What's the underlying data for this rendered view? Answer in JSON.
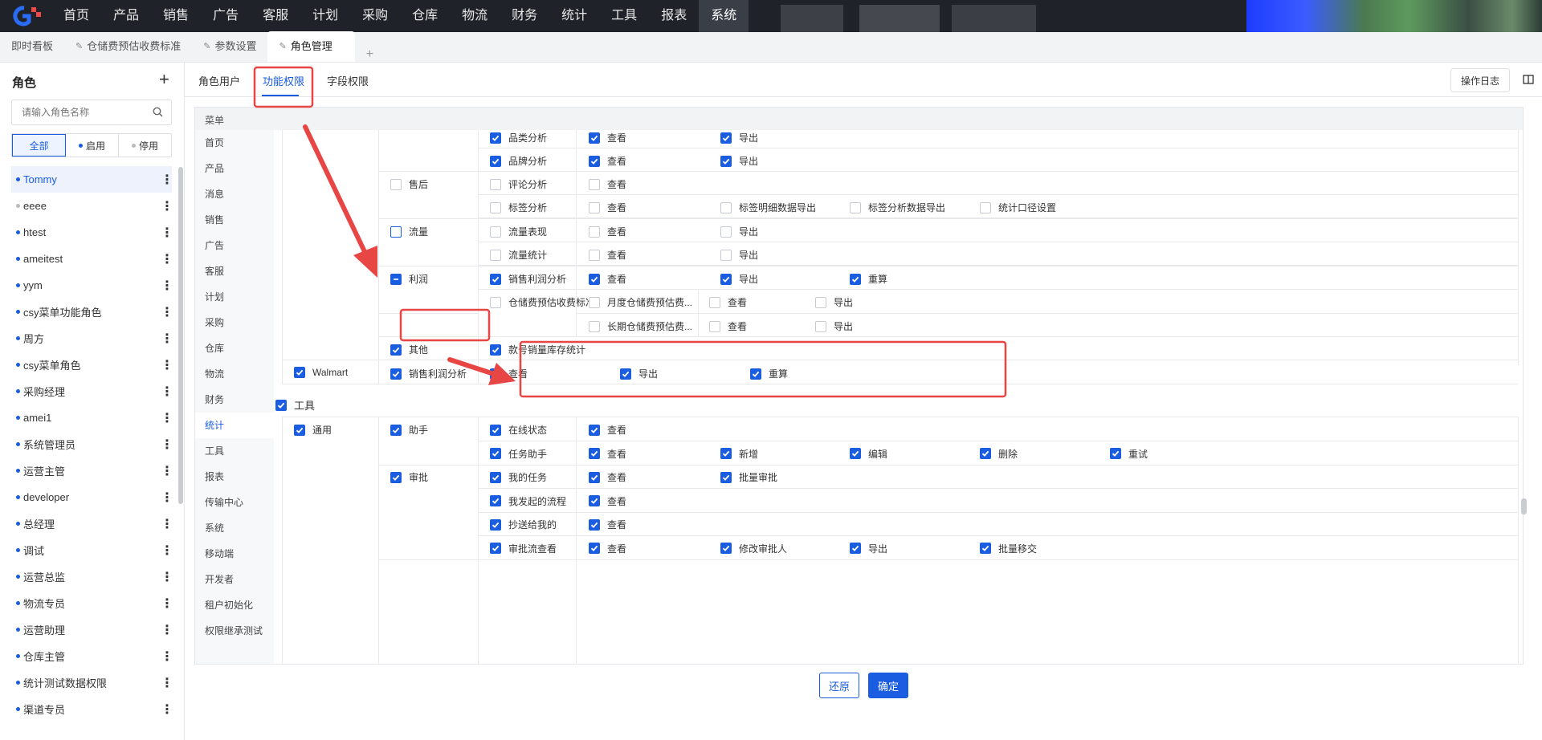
{
  "topnav": {
    "items": [
      "首页",
      "产品",
      "销售",
      "广告",
      "客服",
      "计划",
      "采购",
      "仓库",
      "物流",
      "财务",
      "统计",
      "工具",
      "报表",
      "系统"
    ],
    "active": "系统"
  },
  "page_tabs": [
    {
      "label": "即时看板",
      "pinned": false
    },
    {
      "label": "仓储费预估收费标准",
      "pinned": true
    },
    {
      "label": "参数设置",
      "pinned": true
    },
    {
      "label": "角色管理",
      "pinned": true,
      "active": true
    }
  ],
  "sidebar": {
    "title": "角色",
    "search_placeholder": "请输入角色名称",
    "filters": [
      {
        "label": "全部",
        "active": true
      },
      {
        "label": "启用",
        "dot_color": "#1a5de0"
      },
      {
        "label": "停用",
        "dot_color": "#bbbbbb"
      }
    ],
    "roles": [
      {
        "name": "Tommy",
        "enabled": true,
        "active": true
      },
      {
        "name": "eeee",
        "enabled": false
      },
      {
        "name": "htest",
        "enabled": true
      },
      {
        "name": "ameitest",
        "enabled": true
      },
      {
        "name": "yym",
        "enabled": true
      },
      {
        "name": "csy菜单功能角色",
        "enabled": true
      },
      {
        "name": "周方",
        "enabled": true
      },
      {
        "name": "csy菜单角色",
        "enabled": true
      },
      {
        "name": "采购经理",
        "enabled": true
      },
      {
        "name": "amei1",
        "enabled": true
      },
      {
        "name": "系统管理员",
        "enabled": true
      },
      {
        "name": "运营主管",
        "enabled": true
      },
      {
        "name": "developer",
        "enabled": true
      },
      {
        "name": "总经理",
        "enabled": true
      },
      {
        "name": "调试",
        "enabled": true
      },
      {
        "name": "运营总监",
        "enabled": true
      },
      {
        "name": "物流专员",
        "enabled": true
      },
      {
        "name": "运营助理",
        "enabled": true
      },
      {
        "name": "仓库主管",
        "enabled": true
      },
      {
        "name": "统计测试数据权限",
        "enabled": true
      },
      {
        "name": "渠道专员",
        "enabled": true
      }
    ]
  },
  "subtabs": [
    {
      "label": "角色用户"
    },
    {
      "label": "功能权限",
      "active": true
    },
    {
      "label": "字段权限"
    }
  ],
  "oplog_label": "操作日志",
  "menu_header": "菜单",
  "menu_items": [
    "首页",
    "产品",
    "消息",
    "销售",
    "广告",
    "客服",
    "计划",
    "采购",
    "仓库",
    "物流",
    "财务",
    "统计",
    "工具",
    "报表",
    "传输中心",
    "系统",
    "移动端",
    "开发者",
    "租户初始化",
    "权限继承测试"
  ],
  "menu_active": "统计",
  "permissions": {
    "stats_rows": [
      {
        "feature": "品类分析",
        "checked": true,
        "actions": [
          {
            "l": "查看",
            "c": true
          },
          {
            "l": "导出",
            "c": true
          }
        ]
      },
      {
        "feature": "品牌分析",
        "checked": true,
        "actions": [
          {
            "l": "查看",
            "c": true
          },
          {
            "l": "导出",
            "c": true
          }
        ]
      },
      {
        "group": "售后",
        "group_checked": false,
        "feature": "评论分析",
        "checked": false,
        "actions": [
          {
            "l": "查看",
            "c": false
          }
        ]
      },
      {
        "feature": "标签分析",
        "checked": false,
        "actions": [
          {
            "l": "查看",
            "c": false
          },
          {
            "l": "标签明细数据导出",
            "c": false
          },
          {
            "l": "标签分析数据导出",
            "c": false
          },
          {
            "l": "统计口径设置",
            "c": false
          }
        ]
      },
      {
        "group": "流量",
        "group_checked": false,
        "feature": "流量表现",
        "checked": false,
        "actions": [
          {
            "l": "查看",
            "c": false
          },
          {
            "l": "导出",
            "c": false
          }
        ]
      },
      {
        "feature": "流量统计",
        "checked": false,
        "actions": [
          {
            "l": "查看",
            "c": false
          },
          {
            "l": "导出",
            "c": false
          }
        ]
      },
      {
        "group": "利润",
        "group_state": "indeterminate",
        "feature": "销售利润分析",
        "checked": true,
        "actions": [
          {
            "l": "查看",
            "c": true
          },
          {
            "l": "导出",
            "c": true
          },
          {
            "l": "重算",
            "c": true
          }
        ]
      }
    ],
    "storage_fee": {
      "label": "仓储费预估收费标准",
      "sub": [
        {
          "label": "月度仓储费预估费...",
          "actions": [
            {
              "l": "查看",
              "c": false
            },
            {
              "l": "导出",
              "c": false
            }
          ]
        },
        {
          "label": "长期仓储费预估费...",
          "actions": [
            {
              "l": "查看",
              "c": false
            },
            {
              "l": "导出",
              "c": false
            }
          ]
        }
      ]
    },
    "other_group": {
      "label": "其他",
      "checked": true,
      "feature": "款号销量库存统计",
      "feature_checked": true
    },
    "walmart": {
      "label": "Walmart",
      "checked": true,
      "group": "销售利润分析",
      "actions": [
        {
          "l": "查看",
          "c": true
        },
        {
          "l": "导出",
          "c": true
        },
        {
          "l": "重算",
          "c": true
        }
      ]
    },
    "tools_section": {
      "label": "工具",
      "module": "通用",
      "groups": [
        {
          "label": "助手",
          "rows": [
            {
              "feature": "在线状态",
              "actions": [
                {
                  "l": "查看",
                  "c": true
                }
              ]
            },
            {
              "feature": "任务助手",
              "actions": [
                {
                  "l": "查看",
                  "c": true
                },
                {
                  "l": "新增",
                  "c": true
                },
                {
                  "l": "编辑",
                  "c": true
                },
                {
                  "l": "删除",
                  "c": true
                },
                {
                  "l": "重试",
                  "c": true
                }
              ]
            }
          ]
        },
        {
          "label": "审批",
          "rows": [
            {
              "feature": "我的任务",
              "actions": [
                {
                  "l": "查看",
                  "c": true
                },
                {
                  "l": "批量审批",
                  "c": true
                }
              ]
            },
            {
              "feature": "我发起的流程",
              "actions": [
                {
                  "l": "查看",
                  "c": true
                }
              ]
            },
            {
              "feature": "抄送给我的",
              "actions": [
                {
                  "l": "查看",
                  "c": true
                }
              ]
            },
            {
              "feature": "审批流查看",
              "actions": [
                {
                  "l": "查看",
                  "c": true
                },
                {
                  "l": "修改审批人",
                  "c": true
                },
                {
                  "l": "导出",
                  "c": true
                },
                {
                  "l": "批量移交",
                  "c": true
                }
              ]
            }
          ]
        }
      ]
    }
  },
  "footer": {
    "reset_label": "还原",
    "ok_label": "确定"
  },
  "colors": {
    "accent": "#1a5de0",
    "annotation": "#e84545",
    "nav_bg": "#1f2329"
  }
}
